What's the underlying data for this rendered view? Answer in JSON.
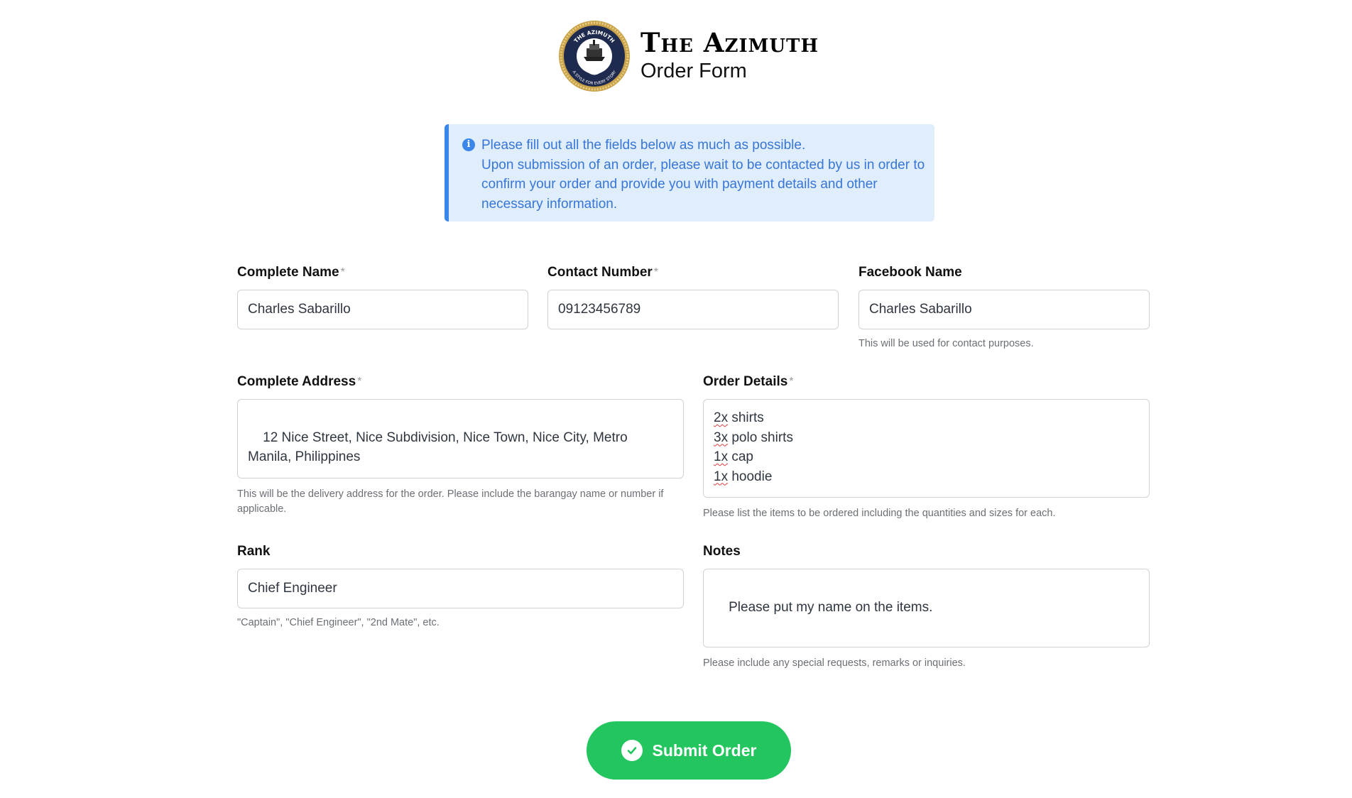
{
  "header": {
    "brand": "The Azimuth",
    "subtitle": "Order Form",
    "logo": {
      "icon": "anchor-ship-seal-icon",
      "top_text": "THE AZIMUTH",
      "bottom_text": "A STYLE FOR EVERY STORY"
    }
  },
  "notice": {
    "icon": "info-icon",
    "line1": "Please fill out all the fields below as much as possible.",
    "line2": "Upon submission of an order, please wait to be contacted by us in order to confirm your order and provide you with payment details and other necessary information."
  },
  "fields": {
    "name": {
      "label": "Complete Name",
      "required_mark": "*",
      "value": "Charles Sabarillo"
    },
    "contact": {
      "label": "Contact Number",
      "required_mark": "*",
      "value": "09123456789"
    },
    "facebook": {
      "label": "Facebook Name",
      "value": "Charles Sabarillo",
      "help": "This will be used for contact purposes."
    },
    "address": {
      "label": "Complete Address",
      "required_mark": "*",
      "value": "12 Nice Street, Nice Subdivision, Nice Town, Nice City, Metro Manila, Philippines",
      "help": "This will be the delivery address for the order. Please include the barangay name or number if applicable."
    },
    "order": {
      "label": "Order Details",
      "required_mark": "*",
      "lines": [
        {
          "qty": "2x",
          "item": " shirts"
        },
        {
          "qty": "3x",
          "item": " polo shirts"
        },
        {
          "qty": "1x",
          "item": " cap"
        },
        {
          "qty": "1x",
          "item": " hoodie"
        }
      ],
      "help": "Please list the items to be ordered including the quantities and sizes for each."
    },
    "rank": {
      "label": "Rank",
      "value": "Chief Engineer",
      "help": "\"Captain\", \"Chief Engineer\", \"2nd Mate\", etc."
    },
    "notes": {
      "label": "Notes",
      "value": "Please put my name on the items.",
      "help": "Please include any special requests, remarks or inquiries."
    }
  },
  "submit": {
    "label": "Submit Order",
    "icon": "check-circle-icon",
    "color": "#22c55e"
  },
  "colors": {
    "info_bg": "#e0edfb",
    "info_accent": "#3b86ea",
    "info_text": "#3776d8"
  }
}
